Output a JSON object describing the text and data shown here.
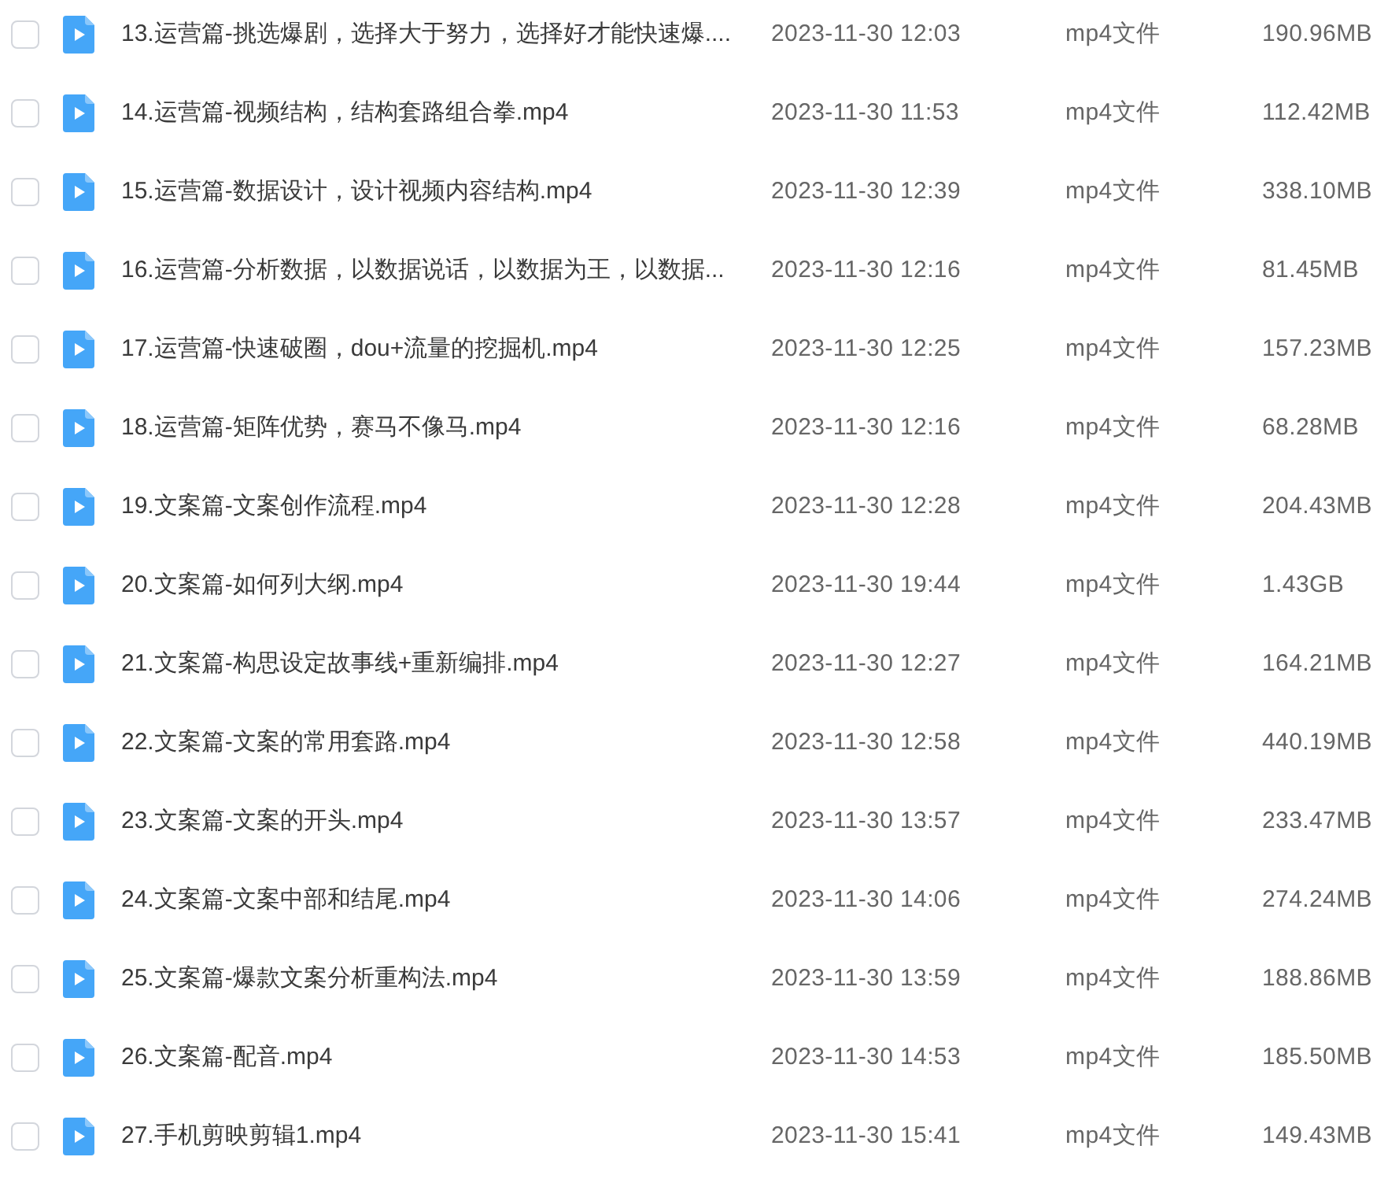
{
  "files": [
    {
      "name": "13.运营篇-挑选爆剧，选择大于努力，选择好才能快速爆....",
      "modified": "2023-11-30 12:03",
      "type": "mp4文件",
      "size": "190.96MB",
      "checked": false
    },
    {
      "name": "14.运营篇-视频结构，结构套路组合拳.mp4",
      "modified": "2023-11-30 11:53",
      "type": "mp4文件",
      "size": "112.42MB",
      "checked": false
    },
    {
      "name": "15.运营篇-数据设计，设计视频内容结构.mp4",
      "modified": "2023-11-30 12:39",
      "type": "mp4文件",
      "size": "338.10MB",
      "checked": false
    },
    {
      "name": "16.运营篇-分析数据，以数据说话，以数据为王，以数据...",
      "modified": "2023-11-30 12:16",
      "type": "mp4文件",
      "size": "81.45MB",
      "checked": false
    },
    {
      "name": "17.运营篇-快速破圈，dou+流量的挖掘机.mp4",
      "modified": "2023-11-30 12:25",
      "type": "mp4文件",
      "size": "157.23MB",
      "checked": false
    },
    {
      "name": "18.运营篇-矩阵优势，赛马不像马.mp4",
      "modified": "2023-11-30 12:16",
      "type": "mp4文件",
      "size": "68.28MB",
      "checked": false
    },
    {
      "name": "19.文案篇-文案创作流程.mp4",
      "modified": "2023-11-30 12:28",
      "type": "mp4文件",
      "size": "204.43MB",
      "checked": false
    },
    {
      "name": "20.文案篇-如何列大纲.mp4",
      "modified": "2023-11-30 19:44",
      "type": "mp4文件",
      "size": "1.43GB",
      "checked": false
    },
    {
      "name": "21.文案篇-构思设定故事线+重新编排.mp4",
      "modified": "2023-11-30 12:27",
      "type": "mp4文件",
      "size": "164.21MB",
      "checked": false
    },
    {
      "name": "22.文案篇-文案的常用套路.mp4",
      "modified": "2023-11-30 12:58",
      "type": "mp4文件",
      "size": "440.19MB",
      "checked": false
    },
    {
      "name": "23.文案篇-文案的开头.mp4",
      "modified": "2023-11-30 13:57",
      "type": "mp4文件",
      "size": "233.47MB",
      "checked": false
    },
    {
      "name": "24.文案篇-文案中部和结尾.mp4",
      "modified": "2023-11-30 14:06",
      "type": "mp4文件",
      "size": "274.24MB",
      "checked": false
    },
    {
      "name": "25.文案篇-爆款文案分析重构法.mp4",
      "modified": "2023-11-30 13:59",
      "type": "mp4文件",
      "size": "188.86MB",
      "checked": false
    },
    {
      "name": "26.文案篇-配音.mp4",
      "modified": "2023-11-30 14:53",
      "type": "mp4文件",
      "size": "185.50MB",
      "checked": false
    },
    {
      "name": "27.手机剪映剪辑1.mp4",
      "modified": "2023-11-30 15:41",
      "type": "mp4文件",
      "size": "149.43MB",
      "checked": false
    }
  ]
}
